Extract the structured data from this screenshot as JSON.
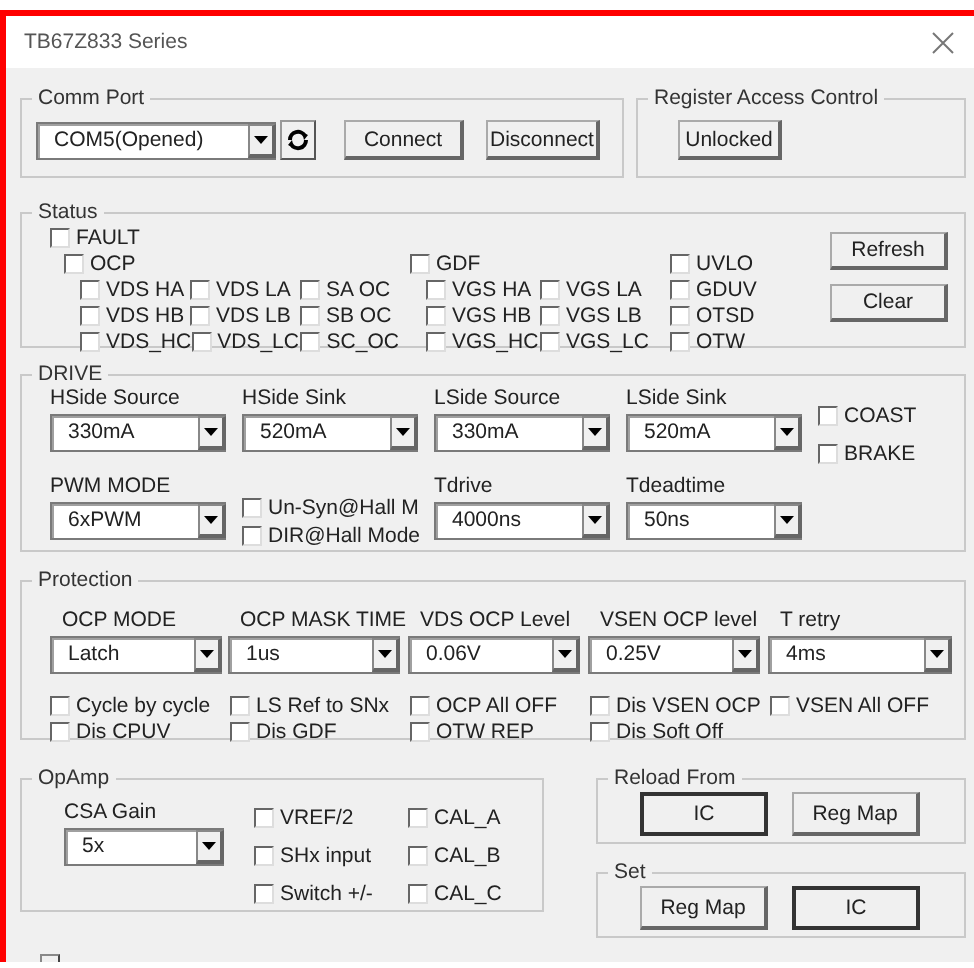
{
  "window": {
    "title": "TB67Z833 Series"
  },
  "comm_port": {
    "title": "Comm Port",
    "port": "COM5(Opened)",
    "buttons": [
      "Connect",
      "Disconnect"
    ]
  },
  "register_access": {
    "title": "Register Access Control",
    "button": "Unlocked"
  },
  "status": {
    "title": "Status",
    "fault": {
      "label": "FAULT",
      "checked": false
    },
    "groups": [
      {
        "label": "OCP",
        "checked": false,
        "rows": [
          [
            {
              "label": "VDS HA",
              "checked": false
            },
            {
              "label": "VDS LA",
              "checked": false
            },
            {
              "label": "SA OC",
              "checked": false
            }
          ],
          [
            {
              "label": "VDS HB",
              "checked": false
            },
            {
              "label": "VDS LB",
              "checked": false
            },
            {
              "label": "SB OC",
              "checked": false
            }
          ],
          [
            {
              "label": "VDS_HC",
              "checked": false
            },
            {
              "label": "VDS_LC",
              "checked": false
            },
            {
              "label": "SC_OC",
              "checked": false
            }
          ]
        ]
      },
      {
        "label": "GDF",
        "checked": false,
        "rows": [
          [
            {
              "label": "VGS HA",
              "checked": false
            },
            {
              "label": "VGS LA",
              "checked": false
            }
          ],
          [
            {
              "label": "VGS HB",
              "checked": false
            },
            {
              "label": "VGS LB",
              "checked": false
            }
          ],
          [
            {
              "label": "VGS_HC",
              "checked": false
            },
            {
              "label": "VGS_LC",
              "checked": false
            }
          ]
        ]
      },
      {
        "label": "UVLO",
        "checked": false,
        "rows": [
          [
            {
              "label": "GDUV",
              "checked": false
            }
          ],
          [
            {
              "label": "OTSD",
              "checked": false
            }
          ],
          [
            {
              "label": "OTW",
              "checked": false
            }
          ]
        ]
      }
    ],
    "buttons": [
      "Refresh",
      "Clear"
    ]
  },
  "drive": {
    "title": "DRIVE",
    "items": [
      {
        "kind": "dropdown",
        "label": "HSide Source",
        "value": "330mA"
      },
      {
        "kind": "dropdown",
        "label": "HSide Sink",
        "value": "520mA"
      },
      {
        "kind": "dropdown",
        "label": "LSide Source",
        "value": "330mA"
      },
      {
        "kind": "dropdown",
        "label": "LSide Sink",
        "value": "520mA"
      },
      {
        "kind": "checks",
        "checks": [
          {
            "label": "COAST",
            "checked": false
          },
          {
            "label": "BRAKE",
            "checked": false
          }
        ]
      },
      {
        "kind": "dropdown",
        "label": "PWM MODE",
        "value": "6xPWM"
      },
      {
        "kind": "checks",
        "checks": [
          {
            "label": "Un-Syn@Hall M",
            "checked": false
          },
          {
            "label": "DIR@Hall Mode",
            "checked": false
          }
        ]
      },
      {
        "kind": "dropdown",
        "label": "Tdrive",
        "value": "4000ns"
      },
      {
        "kind": "dropdown",
        "label": "Tdeadtime",
        "value": "50ns"
      }
    ]
  },
  "protection": {
    "title": "Protection",
    "dropdowns": [
      {
        "label": "OCP MODE",
        "value": "Latch"
      },
      {
        "label": "OCP MASK TIME",
        "value": "1us"
      },
      {
        "label": "VDS OCP Level",
        "value": "0.06V"
      },
      {
        "label": "VSEN OCP level",
        "value": "0.25V"
      },
      {
        "label": "T retry",
        "value": "4ms"
      }
    ],
    "checks": [
      {
        "label": "Cycle by cycle",
        "checked": false
      },
      {
        "label": "LS Ref to SNx",
        "checked": false
      },
      {
        "label": "OCP All OFF",
        "checked": false
      },
      {
        "label": "Dis VSEN OCP",
        "checked": false
      },
      {
        "label": "VSEN All OFF",
        "checked": false
      },
      {
        "label": "Dis CPUV",
        "checked": false
      },
      {
        "label": "Dis GDF",
        "checked": false
      },
      {
        "label": "OTW REP",
        "checked": false
      },
      {
        "label": "Dis Soft Off",
        "checked": false
      }
    ]
  },
  "opamp": {
    "title": "OpAmp",
    "gain_label": "CSA Gain",
    "gain": "5x",
    "checks": [
      {
        "label": "VREF/2",
        "checked": false
      },
      {
        "label": "CAL_A",
        "checked": false
      },
      {
        "label": "SHx input",
        "checked": false
      },
      {
        "label": "CAL_B",
        "checked": false
      },
      {
        "label": "Switch +/-",
        "checked": false
      },
      {
        "label": "CAL_C",
        "checked": false
      }
    ]
  },
  "reload_from": {
    "title": "Reload From",
    "buttons": [
      {
        "label": "IC",
        "focused": true
      },
      {
        "label": "Reg Map",
        "focused": false
      }
    ]
  },
  "set": {
    "title": "Set",
    "buttons": [
      {
        "label": "Reg Map",
        "focused": false
      },
      {
        "label": "IC",
        "focused": true
      }
    ]
  }
}
